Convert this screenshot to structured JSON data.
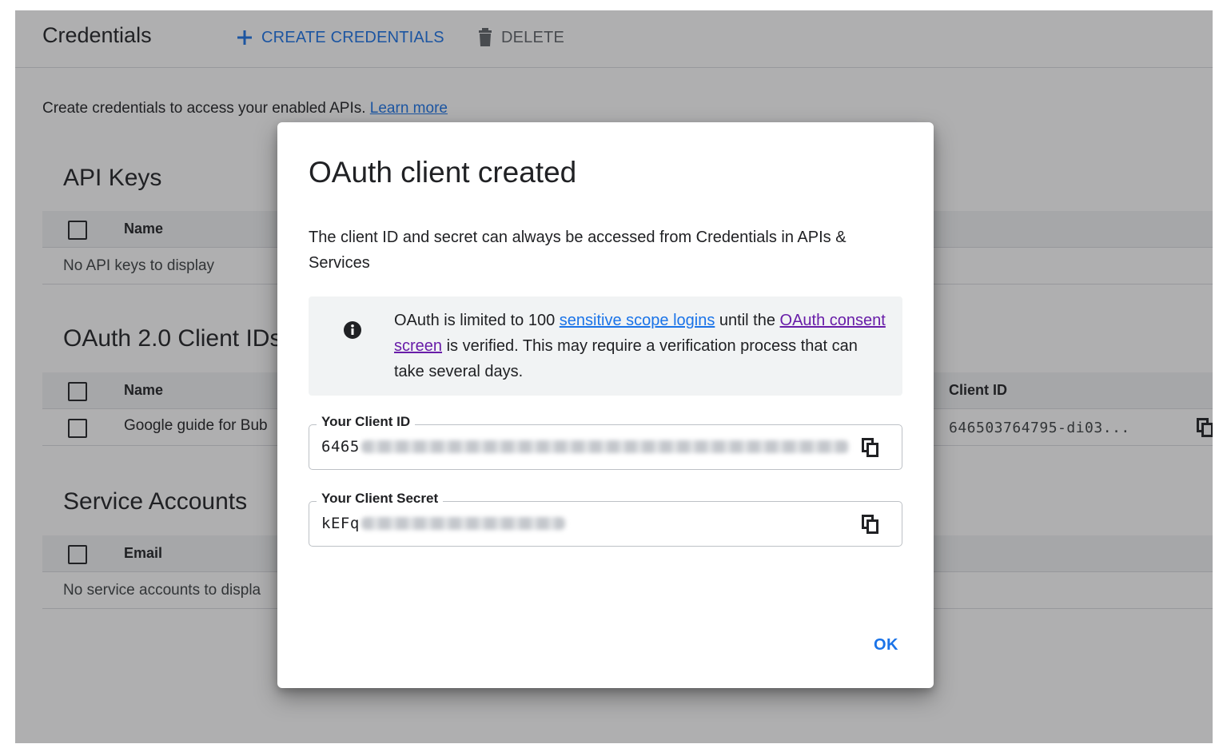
{
  "header": {
    "title": "Credentials",
    "create_label": "CREATE CREDENTIALS",
    "delete_label": "DELETE"
  },
  "intro": {
    "text": "Create credentials to access your enabled APIs.",
    "learn_more": "Learn more"
  },
  "api_keys": {
    "title": "API Keys",
    "column_name": "Name",
    "empty": "No API keys to display"
  },
  "oauth_clients": {
    "title": "OAuth 2.0 Client IDs",
    "column_name": "Name",
    "column_client_id": "Client ID",
    "rows": [
      {
        "name": "Google guide for Bub",
        "client_id": "646503764795-di03..."
      }
    ]
  },
  "service_accounts": {
    "title": "Service Accounts",
    "column_email": "Email",
    "empty": "No service accounts to displa"
  },
  "dialog": {
    "title": "OAuth client created",
    "description": "The client ID and secret can always be accessed from Credentials in APIs & Services",
    "info": {
      "prefix": "OAuth is limited to 100",
      "link_scope": "sensitive scope logins",
      "middle": "until the",
      "link_consent": "OAuth consent screen",
      "suffix": "is verified. This may require a verification process that can take several days."
    },
    "client_id": {
      "label": "Your Client ID",
      "value_visible": "6465"
    },
    "client_secret": {
      "label": "Your Client Secret",
      "value_visible": "kEFq"
    },
    "ok_label": "OK"
  },
  "colors": {
    "accent": "#1a73e8",
    "visited_link": "#681da8",
    "scrim": "rgba(32,33,36,0.36)"
  },
  "icons": [
    "plus-icon",
    "trash-icon",
    "info-icon",
    "copy-icon"
  ]
}
